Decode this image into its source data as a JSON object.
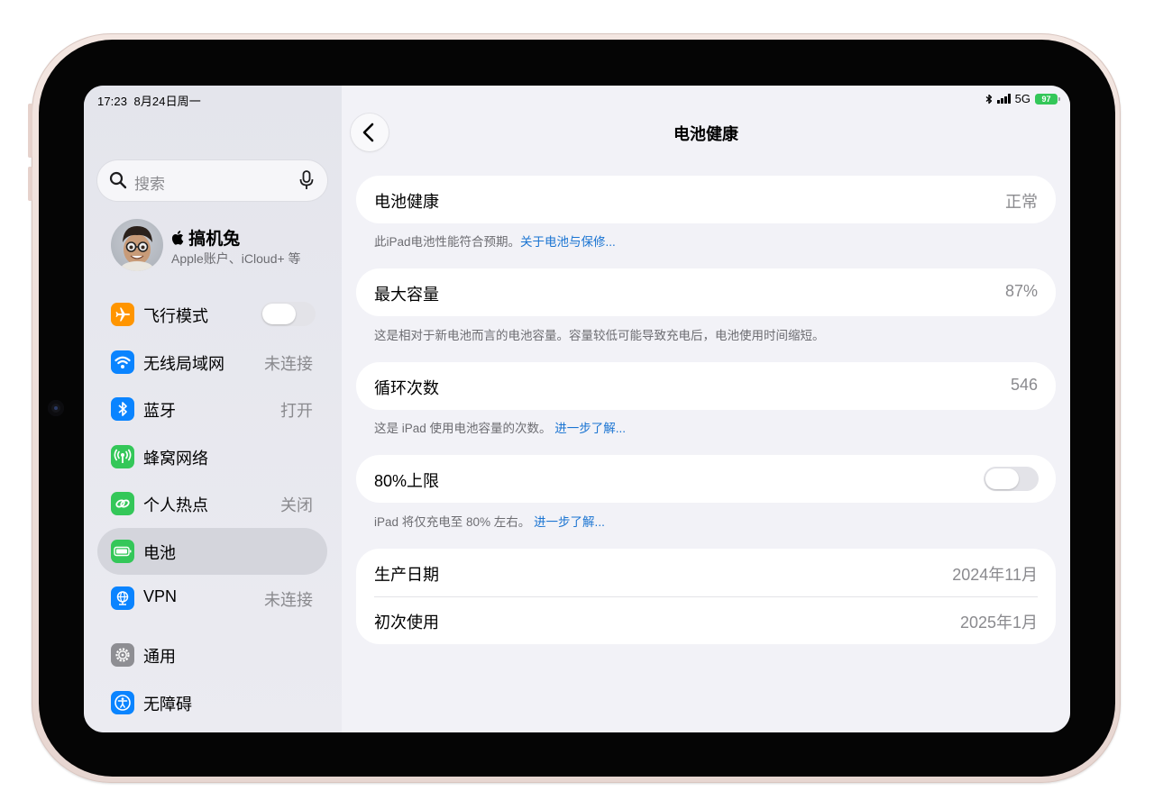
{
  "status": {
    "time": "17:23",
    "date": "8月24日周一",
    "network": "5G",
    "battery_level": "97",
    "icons": [
      "bluetooth-icon",
      "signal-bars-icon",
      "battery-icon"
    ]
  },
  "sidebar": {
    "search_placeholder": "搜索",
    "profile": {
      "name": " 搞机兔",
      "subtitle": "Apple账户、iCloud+ 等"
    },
    "items": [
      {
        "label": "飞行模式",
        "value": "",
        "icon": "airplane-icon",
        "color": "#ff9500",
        "toggle": false
      },
      {
        "label": "无线局域网",
        "value": "未连接",
        "icon": "wifi-icon",
        "color": "#0a84ff"
      },
      {
        "label": "蓝牙",
        "value": "打开",
        "icon": "bluetooth-icon",
        "color": "#0a84ff"
      },
      {
        "label": "蜂窝网络",
        "value": "",
        "icon": "cellular-icon",
        "color": "#34c759"
      },
      {
        "label": "个人热点",
        "value": "关闭",
        "icon": "hotspot-icon",
        "color": "#34c759"
      },
      {
        "label": "电池",
        "value": "",
        "icon": "battery-icon",
        "color": "#34c759",
        "selected": true
      },
      {
        "label": "VPN",
        "value": "未连接",
        "icon": "vpn-icon",
        "color": "#0a84ff"
      },
      {
        "label": "通用",
        "value": "",
        "icon": "gear-icon",
        "color": "#8e8e93"
      },
      {
        "label": "无障碍",
        "value": "",
        "icon": "accessibility-icon",
        "color": "#0a84ff"
      }
    ]
  },
  "main": {
    "title": "电池健康",
    "sections": [
      {
        "label": "电池健康",
        "value": "正常",
        "note": "此iPad电池性能符合预期。",
        "note_link": "关于电池与保修..."
      },
      {
        "label": "最大容量",
        "value": "87%",
        "note": "这是相对于新电池而言的电池容量。容量较低可能导致充电后，电池使用时间缩短。",
        "note_link": ""
      },
      {
        "label": "循环次数",
        "value": "546",
        "note": "这是 iPad 使用电池容量的次数。",
        "note_link": "进一步了解..."
      },
      {
        "label": "80%上限",
        "value": "",
        "toggle": false,
        "note": "iPad 将仅充电至 80% 左右。",
        "note_link": "进一步了解..."
      }
    ],
    "dates": [
      {
        "label": "生产日期",
        "value": "2024年11月"
      },
      {
        "label": "初次使用",
        "value": "2025年1月"
      }
    ]
  },
  "colors": {
    "accent": "#1a74d2",
    "battery_green": "#34c759",
    "selected_row": "#d4d5dc"
  }
}
